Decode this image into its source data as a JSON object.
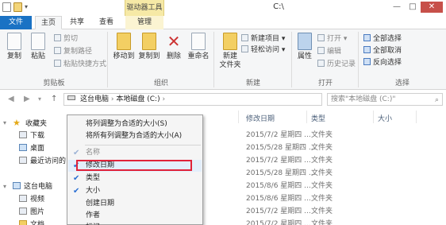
{
  "titlebar": {
    "contextual_group": "驱动器工具",
    "title": "C:\\",
    "minimize": "—",
    "maximize": "□",
    "close": "✕"
  },
  "tabs": {
    "file": "文件",
    "home": "主页",
    "share": "共享",
    "view": "查看",
    "manage": "管理"
  },
  "ribbon": {
    "clipboard": {
      "label": "剪贴板",
      "copy": "复制",
      "paste": "粘贴",
      "cut": "剪切",
      "copy_path": "复制路径",
      "paste_shortcut": "粘贴快捷方式"
    },
    "organize": {
      "label": "组织",
      "move_to": "移动到",
      "copy_to": "复制到",
      "delete": "删除",
      "rename": "重命名"
    },
    "new": {
      "label": "新建",
      "new_folder": "新建\n文件夹",
      "new_item": "新建项目",
      "easy_access": "轻松访问"
    },
    "open": {
      "label": "打开",
      "properties": "属性",
      "open": "打开",
      "edit": "编辑",
      "history": "历史记录"
    },
    "select": {
      "label": "选择",
      "select_all": "全部选择",
      "select_none": "全部取消",
      "invert": "反向选择"
    }
  },
  "address": {
    "path": [
      "这台电脑",
      "本地磁盘 (C:)"
    ],
    "search_placeholder": "搜索\"本地磁盘 (C:)\""
  },
  "nav_pane": {
    "favorites": "收藏夹",
    "downloads": "下载",
    "desktop": "桌面",
    "recent": "最近访问的",
    "this_pc": "这台电脑",
    "videos": "视频",
    "pictures": "图片",
    "documents": "文档"
  },
  "columns": {
    "modified": "修改日期",
    "type": "类型",
    "size": "大小"
  },
  "rows": [
    {
      "date": "2015/7/2 星期四 ...",
      "type": "文件夹"
    },
    {
      "date": "2015/5/28 星期四 ...",
      "type": "文件夹"
    },
    {
      "date": "2015/7/2 星期四 ...",
      "type": "文件夹"
    },
    {
      "date": "2015/5/28 星期四 ...",
      "type": "文件夹"
    },
    {
      "date": "2015/8/6 星期四 ...",
      "type": "文件夹"
    },
    {
      "date": "2015/8/6 星期四 ...",
      "type": "文件夹"
    },
    {
      "date": "2015/7/2 星期四 ...",
      "type": "文件夹"
    },
    {
      "date": "2015/7/2 星期四 ...",
      "type": "文件夹"
    },
    {
      "date": "2015/7/2 星期四 ...",
      "type": "文件夹"
    }
  ],
  "context_menu": {
    "size_column": "将列调整为合适的大小(S)",
    "size_all": "将所有列调整为合适的大小(A)",
    "name": "名称",
    "modified": "修改日期",
    "type": "类型",
    "size": "大小",
    "created": "创建日期",
    "author": "作者",
    "tags": "标记"
  },
  "colors": {
    "file_tab": "#1a72c4",
    "highlight_border": "#e0223a",
    "check": "#2a6fd3"
  }
}
